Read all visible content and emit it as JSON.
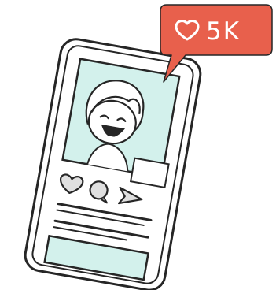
{
  "notification": {
    "icon": "heart-icon",
    "likes_text": "5K",
    "bubble_color": "#e8604c",
    "text_color": "#ffffff"
  },
  "phone": {
    "body_color": "#ffffff",
    "outline_color": "#262626",
    "screen_accent": "#d3f1ec"
  },
  "post": {
    "actions": [
      "heart-icon",
      "comment-icon",
      "send-icon"
    ]
  }
}
